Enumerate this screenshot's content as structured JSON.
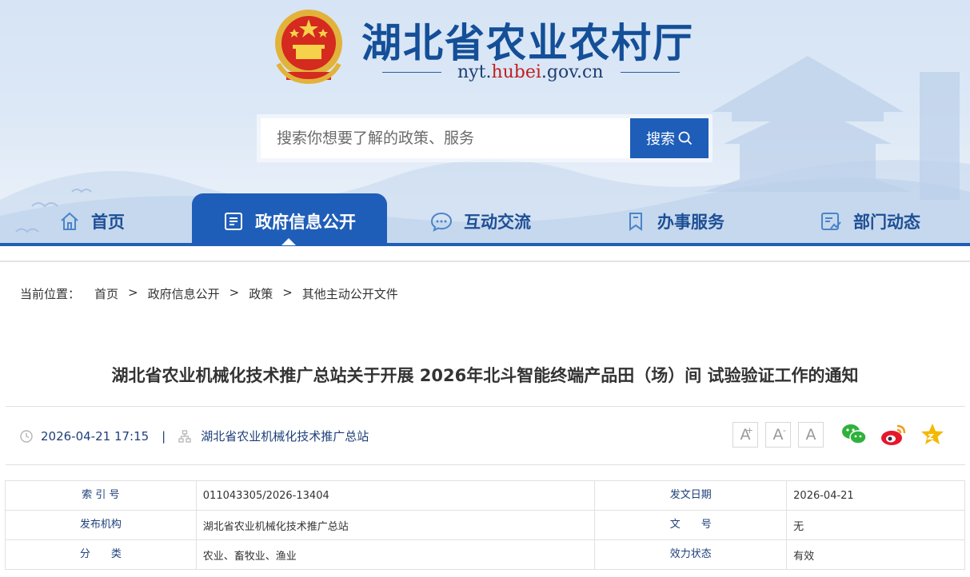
{
  "site": {
    "title": "湖北省农业农村厅",
    "url_prefix": "nyt.",
    "url_highlight": "hubei",
    "url_suffix": ".gov.cn",
    "emblem_icon": "national-emblem-icon",
    "brand_color": "#1f5eb8",
    "title_color": "#144f98"
  },
  "search": {
    "placeholder": "搜索你想要了解的政策、服务",
    "button_label": "搜索"
  },
  "nav": {
    "items": [
      {
        "label": "首页",
        "icon": "home-icon",
        "active": false
      },
      {
        "label": "政府信息公开",
        "icon": "document-list-icon",
        "active": true
      },
      {
        "label": "互动交流",
        "icon": "chat-bubble-icon",
        "active": false
      },
      {
        "label": "办事服务",
        "icon": "bookmark-icon",
        "active": false
      },
      {
        "label": "部门动态",
        "icon": "report-chart-icon",
        "active": false
      }
    ]
  },
  "breadcrumb": {
    "lead": "当前位置：",
    "separator": ">",
    "items": [
      "首页",
      "政府信息公开",
      "政策",
      "其他主动公开文件"
    ]
  },
  "article": {
    "title": "湖北省农业机械化技术推广总站关于开展 2026年北斗智能终端产品田（场）间 试验验证工作的通知",
    "datetime": "2026-04-21 17:15",
    "pipe": "|",
    "source": "湖北省农业机械化技术推广总站",
    "font_sizes": {
      "large": "A",
      "large_mark": "+",
      "small": "A",
      "small_mark": "-",
      "default": "A"
    },
    "share_icons": [
      "wechat-icon",
      "weibo-icon",
      "favorite-star-icon"
    ]
  },
  "info": {
    "rows": [
      {
        "label1": "索 引 号",
        "value1": "011043305/2026-13404",
        "label2": "发文日期",
        "value2": "2026-04-21"
      },
      {
        "label1": "发布机构",
        "value1": "湖北省农业机械化技术推广总站",
        "label2": "文　　号",
        "value2": "无"
      },
      {
        "label1": "分　　类",
        "value1": "农业、畜牧业、渔业",
        "label2": "效力状态",
        "value2": "有效"
      }
    ]
  }
}
